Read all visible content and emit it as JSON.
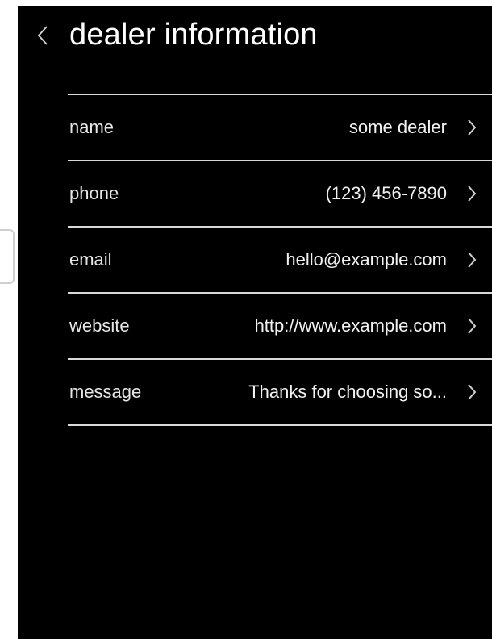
{
  "header": {
    "title": "dealer information",
    "back_icon": "chevron-left-icon"
  },
  "rows": [
    {
      "label": "name",
      "value": "some dealer",
      "icon": "chevron-right-icon"
    },
    {
      "label": "phone",
      "value": "(123) 456-7890",
      "icon": "chevron-right-icon"
    },
    {
      "label": "email",
      "value": "hello@example.com",
      "icon": "chevron-right-icon"
    },
    {
      "label": "website",
      "value": "http://www.example.com",
      "icon": "chevron-right-icon"
    },
    {
      "label": "message",
      "value": "Thanks for choosing so...",
      "icon": "chevron-right-icon"
    }
  ],
  "colors": {
    "background": "#000000",
    "text": "#ffffff",
    "divider": "#d9d9d9"
  }
}
